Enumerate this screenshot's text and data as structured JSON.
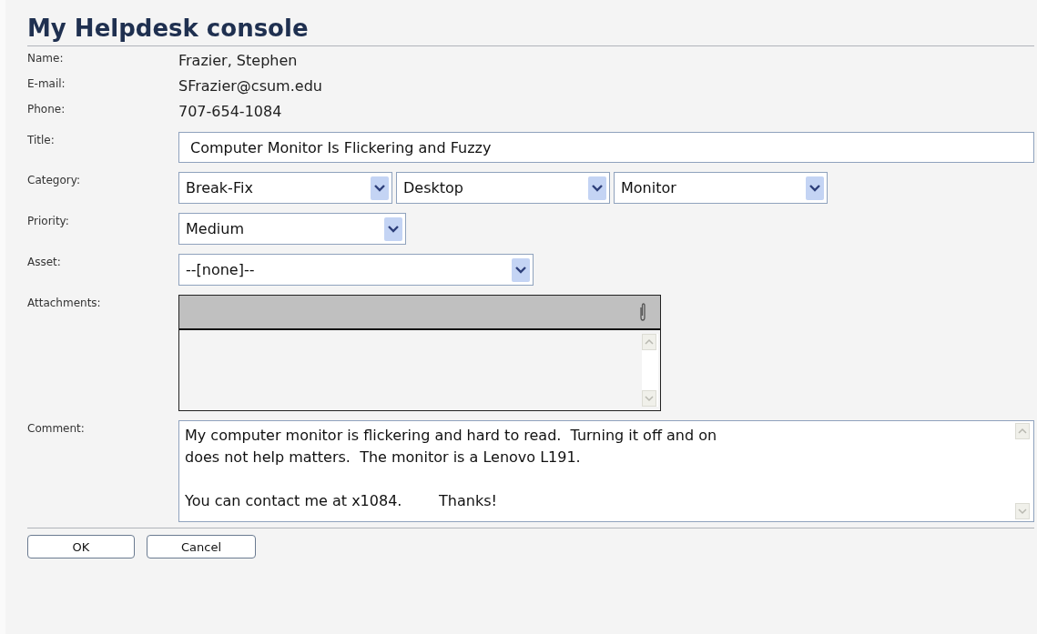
{
  "heading": "My Helpdesk console",
  "info": [
    {
      "label": "Name:",
      "value": "Frazier, Stephen"
    },
    {
      "label": "E-mail:",
      "value": "SFrazier@csum.edu"
    },
    {
      "label": "Phone:",
      "value": "707-654-1084"
    }
  ],
  "title_field": {
    "label": "Title:",
    "value": "Computer Monitor Is Flickering and Fuzzy"
  },
  "category": {
    "label": "Category:",
    "values": [
      "Break-Fix",
      "Desktop",
      "Monitor"
    ]
  },
  "priority": {
    "label": "Priority:",
    "value": "Medium"
  },
  "asset": {
    "label": "Asset:",
    "value": "--[none]--"
  },
  "attachments": {
    "label": "Attachments:"
  },
  "comment": {
    "label": "Comment:",
    "value": "My computer monitor is flickering and hard to read.  Turning it off and on\ndoes not help matters.  The monitor is a Lenovo L191.\n\nYou can contact me at x1084.        Thanks!"
  },
  "buttons": [
    "OK",
    "Cancel"
  ]
}
